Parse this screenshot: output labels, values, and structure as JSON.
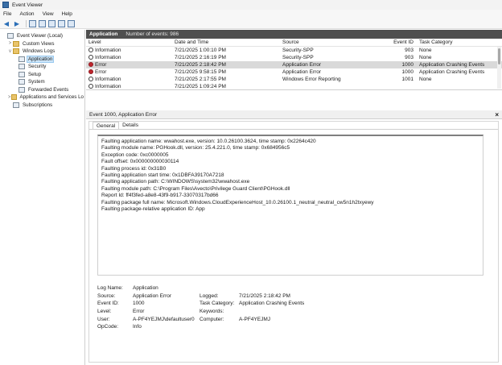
{
  "window": {
    "title": "Event Viewer"
  },
  "menu": [
    "File",
    "Action",
    "View",
    "Help"
  ],
  "tree": [
    {
      "label": "Event Viewer (Local)",
      "indent": 0,
      "expander": "",
      "icon": "computer-icon"
    },
    {
      "label": "Custom Views",
      "indent": 1,
      "expander": ">",
      "icon": "folder-icon"
    },
    {
      "label": "Windows Logs",
      "indent": 1,
      "expander": "v",
      "icon": "folder-icon"
    },
    {
      "label": "Application",
      "indent": 2,
      "expander": "",
      "icon": "log-icon",
      "selected": true
    },
    {
      "label": "Security",
      "indent": 2,
      "expander": "",
      "icon": "log-icon"
    },
    {
      "label": "Setup",
      "indent": 2,
      "expander": "",
      "icon": "log-icon"
    },
    {
      "label": "System",
      "indent": 2,
      "expander": "",
      "icon": "log-icon"
    },
    {
      "label": "Forwarded Events",
      "indent": 2,
      "expander": "",
      "icon": "log-icon"
    },
    {
      "label": "Applications and Services Lo",
      "indent": 1,
      "expander": ">",
      "icon": "folder-icon"
    },
    {
      "label": "Subscriptions",
      "indent": 1,
      "expander": "",
      "icon": "log-icon"
    }
  ],
  "list": {
    "name": "Application",
    "count_text": "Number of events: 986",
    "columns": {
      "level": "Level",
      "date": "Date and Time",
      "source": "Source",
      "id": "Event ID",
      "task": "Task Category"
    },
    "rows": [
      {
        "level": "Information",
        "type": "info",
        "date": "7/21/2025 1:00:10 PM",
        "source": "Security-SPP",
        "id": "903",
        "task": "None"
      },
      {
        "level": "Information",
        "type": "info",
        "date": "7/21/2025 2:16:19 PM",
        "source": "Security-SPP",
        "id": "903",
        "task": "None"
      },
      {
        "level": "Error",
        "type": "error",
        "date": "7/21/2025 2:18:42 PM",
        "source": "Application Error",
        "id": "1000",
        "task": "Application Crashing Events",
        "selected": true
      },
      {
        "level": "Error",
        "type": "error",
        "date": "7/21/2025 9:58:15 PM",
        "source": "Application Error",
        "id": "1000",
        "task": "Application Crashing Events"
      },
      {
        "level": "Information",
        "type": "info",
        "date": "7/21/2025 2:17:55 PM",
        "source": "Windows Error Reporting",
        "id": "1001",
        "task": "None"
      },
      {
        "level": "Information",
        "type": "info",
        "date": "7/21/2025 1:09:24 PM",
        "source": "",
        "id": "",
        "task": ""
      }
    ]
  },
  "detail": {
    "title": "Event 1000, Application Error",
    "close": "×",
    "tabs": [
      "General",
      "Details"
    ],
    "description": [
      "Faulting application name: wwahost.exe, version: 10.0.26100.3624, time stamp: 0x2264c420",
      "Faulting module name: PGHook.dll, version: 25.4.221.0, time stamp: 0x684956c5",
      "Exception code: 0xc0000005",
      "Fault offset: 0x000000000030114",
      "Faulting process id: 0x31B0",
      "Faulting application start time: 0x1DBFA39170A7218",
      "Faulting application path: C:\\WINDOWS\\system32\\wwahost.exe",
      "Faulting module path: C:\\Program Files\\Avecto\\Privilege Guard Client\\PGHook.dll",
      "Report Id: ff4f3fed-a8e8-43f9-b917-33070317bd66",
      "Faulting package full name: Microsoft.Windows.CloudExperienceHost_10.0.26100.1_neutral_neutral_cw5n1h2txyewy",
      "Faulting package-relative application ID: App"
    ],
    "props": [
      {
        "k1": "Log Name:",
        "v1": "Application",
        "k2": "",
        "v2": ""
      },
      {
        "k1": "Source:",
        "v1": "Application Error",
        "k2": "Logged:",
        "v2": "7/21/2025 2:18:42 PM"
      },
      {
        "k1": "Event ID:",
        "v1": "1000",
        "k2": "Task Category:",
        "v2": "Application Crashing Events"
      },
      {
        "k1": "Level:",
        "v1": "Error",
        "k2": "Keywords:",
        "v2": ""
      },
      {
        "k1": "User:",
        "v1": "A-PF4YEJMJ\\defaultuser0",
        "k2": "Computer:",
        "v2": "A-PF4YEJMJ"
      },
      {
        "k1": "OpCode:",
        "v1": "Info",
        "k2": "",
        "v2": ""
      }
    ]
  }
}
